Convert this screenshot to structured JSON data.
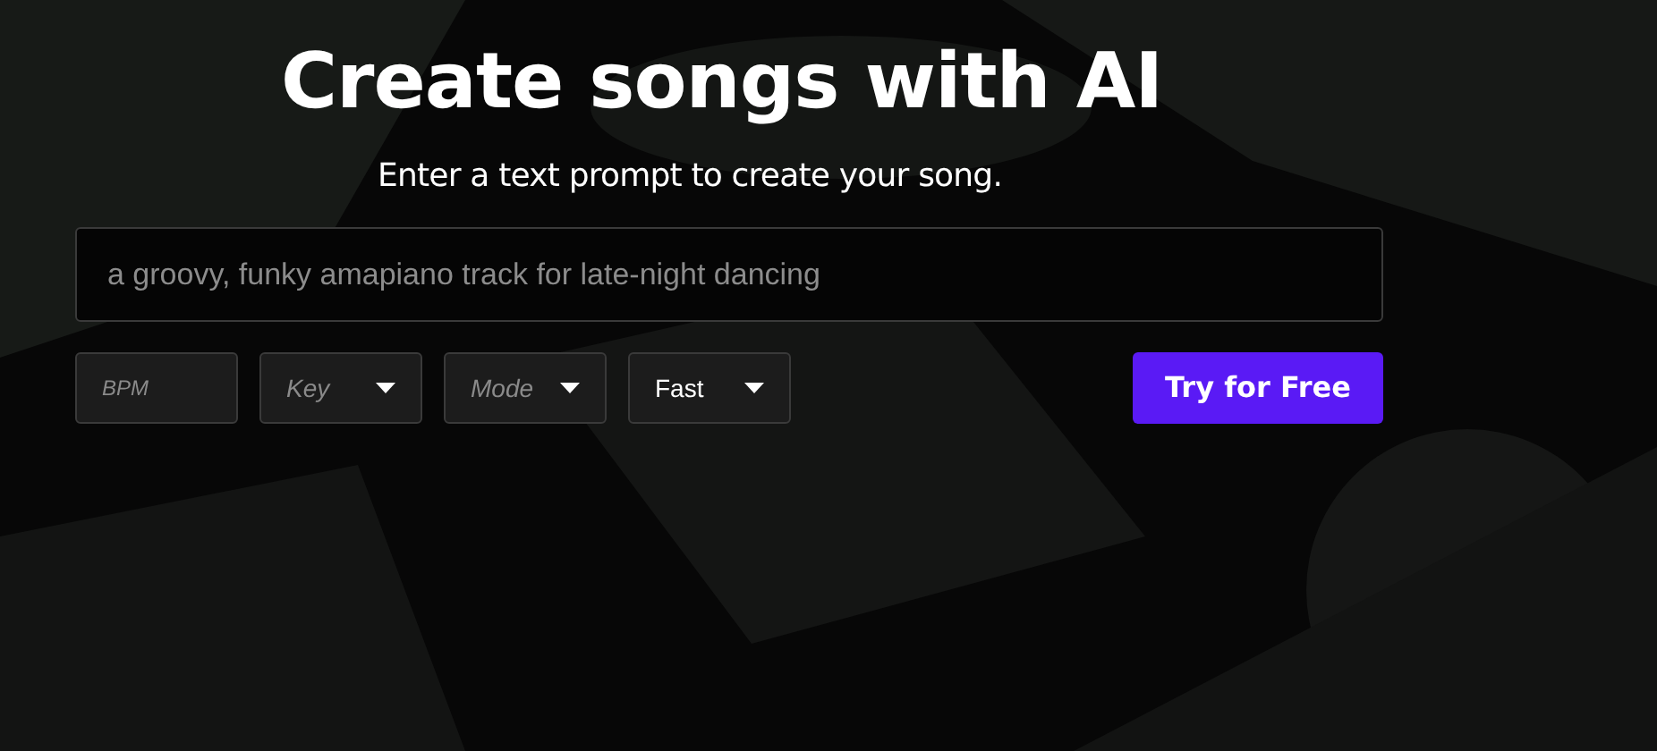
{
  "hero": {
    "title": "Create songs with AI",
    "subtitle": "Enter a text prompt to create your song."
  },
  "prompt": {
    "placeholder": "a groovy, funky amapiano track for late-night dancing"
  },
  "options": [
    {
      "kind": "input",
      "placeholder": "BPM"
    },
    {
      "kind": "select",
      "placeholder": "Key"
    },
    {
      "kind": "select",
      "placeholder": "Mode"
    },
    {
      "kind": "select",
      "value": "Fast"
    }
  ],
  "cta": {
    "label": "Try for Free"
  }
}
